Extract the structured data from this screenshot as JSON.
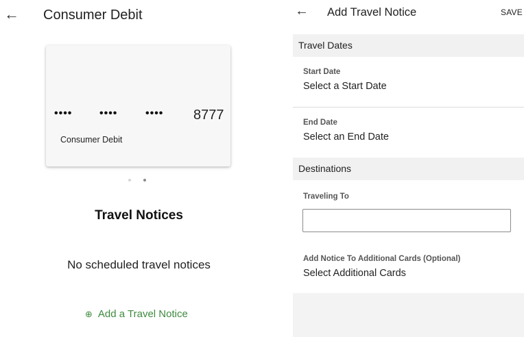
{
  "left_screen": {
    "title": "Consumer Debit",
    "card": {
      "masked_groups": [
        "••••",
        "••••",
        "••••"
      ],
      "last4": "8777",
      "name": "Consumer Debit"
    },
    "pager": {
      "count": 2,
      "active_index": 1
    },
    "section_heading": "Travel Notices",
    "empty_message": "No scheduled travel notices",
    "add_link": {
      "label": "Add a Travel Notice",
      "icon": "add-circle-icon",
      "color": "#3f8a3f"
    }
  },
  "right_screen": {
    "title": "Add Travel Notice",
    "save_label": "SAVE",
    "travel_dates": {
      "header": "Travel Dates",
      "start": {
        "label": "Start Date",
        "value": "Select a Start Date"
      },
      "end": {
        "label": "End Date",
        "value": "Select an End Date"
      }
    },
    "destinations": {
      "header": "Destinations",
      "traveling_to": {
        "label": "Traveling To",
        "value": "",
        "placeholder": ""
      }
    },
    "additional_cards": {
      "label": "Add Notice To Additional Cards (Optional)",
      "value": "Select Additional Cards"
    }
  }
}
